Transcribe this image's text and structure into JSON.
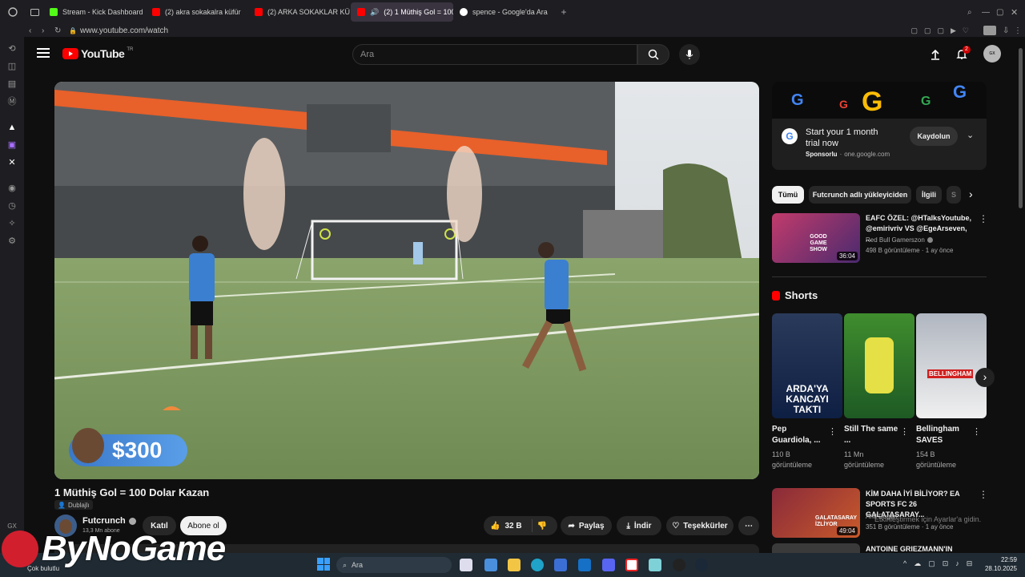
{
  "browser": {
    "tabs": [
      {
        "title": "Stream - Kick Dashboard",
        "color": "#53fc18"
      },
      {
        "title": "(2) akra sokakalra küfür",
        "color": "#ff0000"
      },
      {
        "title": "(2) ARKA SOKAKLAR KÜ",
        "color": "#ff0000"
      },
      {
        "title": "(2) 1 Müthiş Gol = 100",
        "color": "#ff0000"
      },
      {
        "title": "spence - Google'da Ara",
        "color": "#ffffff"
      }
    ],
    "url": "www.youtube.com/watch"
  },
  "youtube": {
    "logo_text": "YouTube",
    "region": "TR",
    "search_placeholder": "Ara",
    "notification_count": "2",
    "avatar_text": "GX",
    "video_title": "1 Müthiş Gol = 100 Dolar Kazan",
    "dub_label": "Dublajlı",
    "channel_name": "Futcrunch",
    "subscribers": "13,3 Mn abone",
    "join_label": "Katıl",
    "subscribe_label": "Abone ol",
    "likes": "32 B",
    "share_label": "Paylaş",
    "download_label": "İndir",
    "thanks_label": "Teşekkürler",
    "overlay_amount": "$300"
  },
  "ad": {
    "title": "Start your 1 month trial now",
    "sponsored": "Sponsorlu",
    "domain": "one.google.com",
    "cta": "Kaydolun"
  },
  "chips": [
    "Tümü",
    "Futcrunch adlı yükleyiciden",
    "İlgili",
    "S"
  ],
  "recommended": [
    {
      "title": "EAFC ÖZEL: @HTalksYoutube, @emirivriv VS @EgeArseven, ...",
      "channel": "Red Bull Gamerszon",
      "stats": "498 B görüntüleme · 1 ay önce",
      "duration": "36:04",
      "thumb_text": "GOOD GAME SHOW"
    },
    {
      "title": "KİM DAHA İYİ BİLİYOR? EA SPORTS FC 26 GALATASARAY...",
      "channel": "Anıl Dogan",
      "stats": "351 B görüntüleme · 1 ay önce",
      "duration": "49:04",
      "thumb_text": "GALATASARAY İZLİYOR"
    },
    {
      "title": "ANTOINE GRIEZMANN'IN",
      "channel": "",
      "stats": "",
      "duration": "",
      "thumb_text": ""
    }
  ],
  "shorts": {
    "heading": "Shorts",
    "items": [
      {
        "title": "Pep Guardiola, ...",
        "views": "110 B",
        "suffix": "görüntüleme",
        "thumb_text": "ARDA'YA KANCAYI TAKTI"
      },
      {
        "title": "Still The same ...",
        "views": "11 Mn",
        "suffix": "görüntüleme",
        "thumb_text": ""
      },
      {
        "title": "Bellingham SAVES",
        "views": "154 B",
        "suffix": "görüntüleme",
        "thumb_text": "BELLINGHAM"
      }
    ]
  },
  "activation": "Etkinleştirmek için Ayarlar'a gidin.",
  "taskbar": {
    "search_placeholder": "Ara",
    "time": "22:59",
    "date": "28.10.2025"
  },
  "watermark": "ByNoGame",
  "status_left": "Çok bulutlu"
}
